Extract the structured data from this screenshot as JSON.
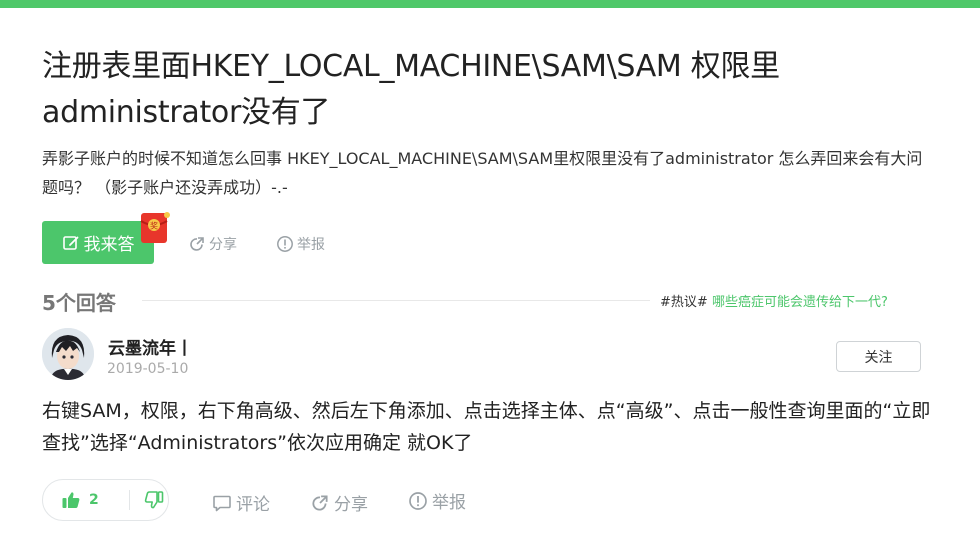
{
  "question": {
    "title": "注册表里面HKEY_LOCAL_MACHINE\\SAM\\SAM 权限里administrator没有了",
    "description": "弄影子账户的时候不知道怎么回事 HKEY_LOCAL_MACHINE\\SAM\\SAM里权限里没有了administrator 怎么弄回来会有大问题吗？ （影子账户还没弄成功）-.-",
    "answer_button": "我来答",
    "redpacket_text": "奖",
    "share_label": "分享",
    "report_label": "举报"
  },
  "answers_header": {
    "count_label": "5个回答",
    "hot_tag": "#热议#",
    "hot_link": "哪些癌症可能会遗传给下一代?"
  },
  "answer": {
    "username": "云墨流年丨",
    "date": "2019-05-10",
    "follow_label": "关注",
    "content": "右键SAM，权限，右下角高级、然后左下角添加、点击选择主体、点“高级”、点击一般性查询里面的“立即查找”选择“Administrators”依次应用确定 就OK了",
    "like_count": "2",
    "comment_label": "评论",
    "share_label": "分享",
    "report_label": "举报"
  },
  "colors": {
    "accent": "#4cc66b",
    "top_bar": "#4fc86a",
    "muted": "#9aa1a6"
  },
  "icons": [
    "edit-icon",
    "share-icon",
    "report-icon",
    "thumb-up-icon",
    "thumb-down-icon",
    "comment-icon",
    "redpacket-icon"
  ]
}
